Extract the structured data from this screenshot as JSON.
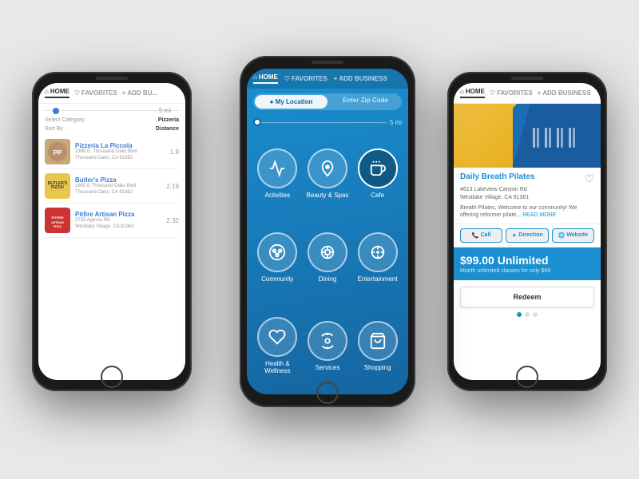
{
  "left_phone": {
    "nav": {
      "home": "HOME",
      "favorites": "FAVORITES",
      "add_business": "+ ADD BU..."
    },
    "distance": "5 mi",
    "select_category_label": "Select Category",
    "select_category_value": "Pizzeria",
    "sort_by_label": "Sort By",
    "sort_by_value": "Distance",
    "restaurants": [
      {
        "name": "Pizzeria La Piccola",
        "address": "2388 E. Thousand Oaks Blvd\nThousand Oaks, CA 91362",
        "distance": "1.9",
        "logo_bg": "#c8a87a",
        "logo_text": ""
      },
      {
        "name": "Butler's Pizza",
        "address": "1655 E Thousand Oaks Blvd\nThousand Oaks, CA 91362",
        "distance": "2.19",
        "logo_bg": "#e8c84a",
        "logo_text": "BUTLER'S PIZZA!"
      },
      {
        "name": "Pitfire Artisan Pizza",
        "address": "2725 Agoura Rd\nWestlake Village, CA 91362",
        "distance": "2.32",
        "logo_bg": "#dd4444",
        "logo_text": ""
      }
    ]
  },
  "center_phone": {
    "nav": {
      "home": "HOME",
      "favorites": "FAVORITES",
      "add_business": "+ ADD BUSINESS"
    },
    "location_toggle": {
      "my_location": "My Location",
      "enter_zip": "Enter Zip Code"
    },
    "distance": "5 mi",
    "categories": [
      {
        "label": "Activities",
        "icon": "activities"
      },
      {
        "label": "Beauty & Spas",
        "icon": "beauty"
      },
      {
        "label": "Cafe",
        "icon": "cafe",
        "selected": true
      },
      {
        "label": "Community",
        "icon": "community"
      },
      {
        "label": "Dining",
        "icon": "dining"
      },
      {
        "label": "Entertainment",
        "icon": "entertainment"
      },
      {
        "label": "Health & Wellness",
        "icon": "health"
      },
      {
        "label": "Services",
        "icon": "services"
      },
      {
        "label": "Shopping",
        "icon": "shopping"
      }
    ]
  },
  "right_phone": {
    "nav": {
      "home": "HOME",
      "favorites": "FAVORITES",
      "add_business": "+ ADD BUSINESS"
    },
    "business": {
      "name": "Daily Breath Pilates",
      "address": "4613 Lakeview Canyon Rd\nWestlake Village, CA 91361",
      "description": "Breath Pilates, Welcome to our community! We offering reformer pilate...",
      "read_more": "READ MORE"
    },
    "actions": {
      "call": "Call",
      "direction": "Direction",
      "website": "Website"
    },
    "promo": {
      "price": "$99.00 Unlimited",
      "description": "Month unlimited classes for only $99"
    },
    "redeem_label": "Redeem"
  }
}
